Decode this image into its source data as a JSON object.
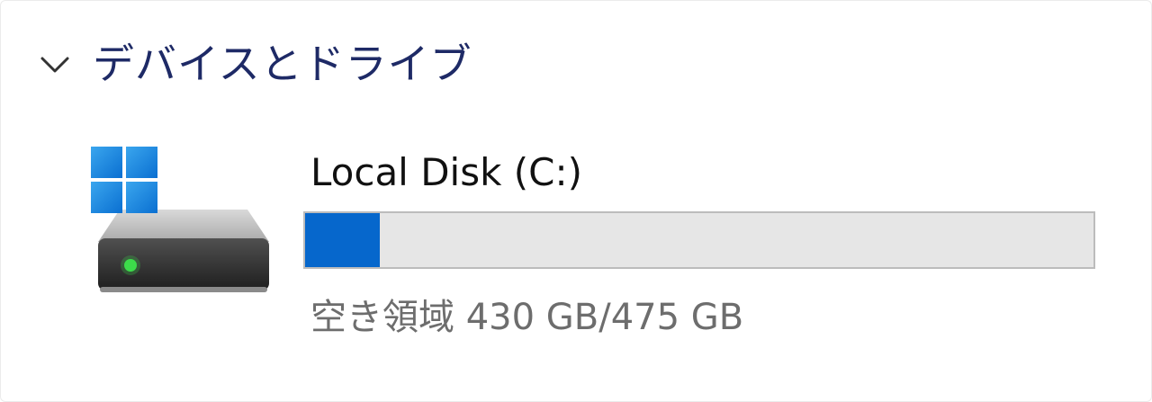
{
  "section": {
    "title": "デバイスとドライブ",
    "chevron_icon": "chevron-down-icon"
  },
  "drives": [
    {
      "name": "Local Disk (C:)",
      "icon": "windows-drive-icon",
      "free_space_label": "空き領域 430 GB/475 GB",
      "used_fraction": 0.0947,
      "colors": {
        "fill": "#0667cc",
        "track": "#e6e6e6"
      }
    }
  ]
}
